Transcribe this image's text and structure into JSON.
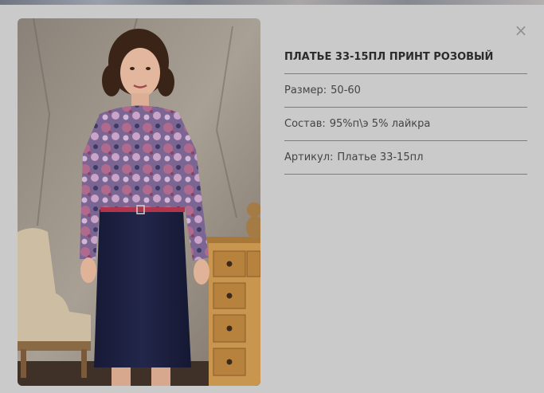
{
  "product": {
    "title": "ПЛАТЬЕ 33-15ПЛ ПРИНТ РОЗОВЫЙ",
    "details": [
      {
        "label": "Размер:",
        "value": "50-60"
      },
      {
        "label": "Состав:",
        "value": "95%п\\э 5% лайкра"
      },
      {
        "label": "Артикул:",
        "value": "Платье 33-15пл"
      }
    ]
  },
  "icons": {
    "close": "×"
  },
  "colors": {
    "modal_bg": "#cacaca",
    "divider": "#7c7c7c",
    "title_text": "#2b2b2b",
    "body_text": "#444444",
    "skirt": "#1b1e3e",
    "print": "#9c6a97",
    "belt": "#b0344c"
  }
}
